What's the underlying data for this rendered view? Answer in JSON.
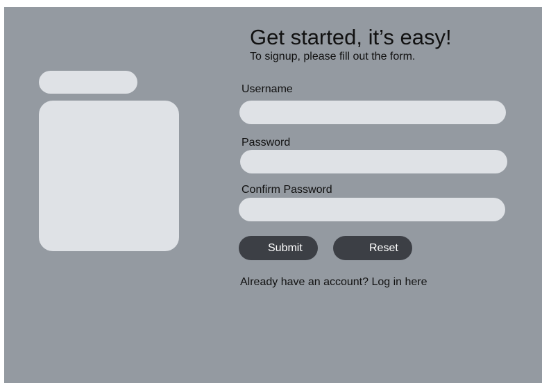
{
  "header": {
    "title": "Get started, it’s easy!",
    "subtitle": "To signup, please fill out the form."
  },
  "form": {
    "username": {
      "label": "Username",
      "value": "",
      "placeholder": ""
    },
    "password": {
      "label": "Password",
      "value": "",
      "placeholder": ""
    },
    "confirm_password": {
      "label": "Confirm Password",
      "value": "",
      "placeholder": ""
    },
    "submit_label": "Submit",
    "reset_label": "Reset"
  },
  "footer": {
    "login_text": "Already have an account? Log in here"
  },
  "colors": {
    "background": "#949aa1",
    "field": "#dfe2e6",
    "button": "#3c3f45",
    "button_text": "#ffffff"
  }
}
